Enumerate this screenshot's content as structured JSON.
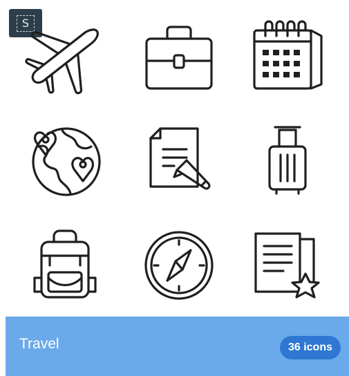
{
  "badge": {
    "letter": "S"
  },
  "pack": {
    "title": "Travel",
    "count": "36 icons",
    "icons": [
      "airplane-icon",
      "briefcase-icon",
      "calendar-icon",
      "globe-pins-icon",
      "document-pen-icon",
      "luggage-icon",
      "backpack-icon",
      "compass-icon",
      "book-star-icon"
    ]
  },
  "colors": {
    "footer_bg": "#6aa9ea",
    "count_bg": "#2e77d2",
    "badge_bg": "#2d3e4a",
    "icon_stroke": "#1f1f1f"
  }
}
